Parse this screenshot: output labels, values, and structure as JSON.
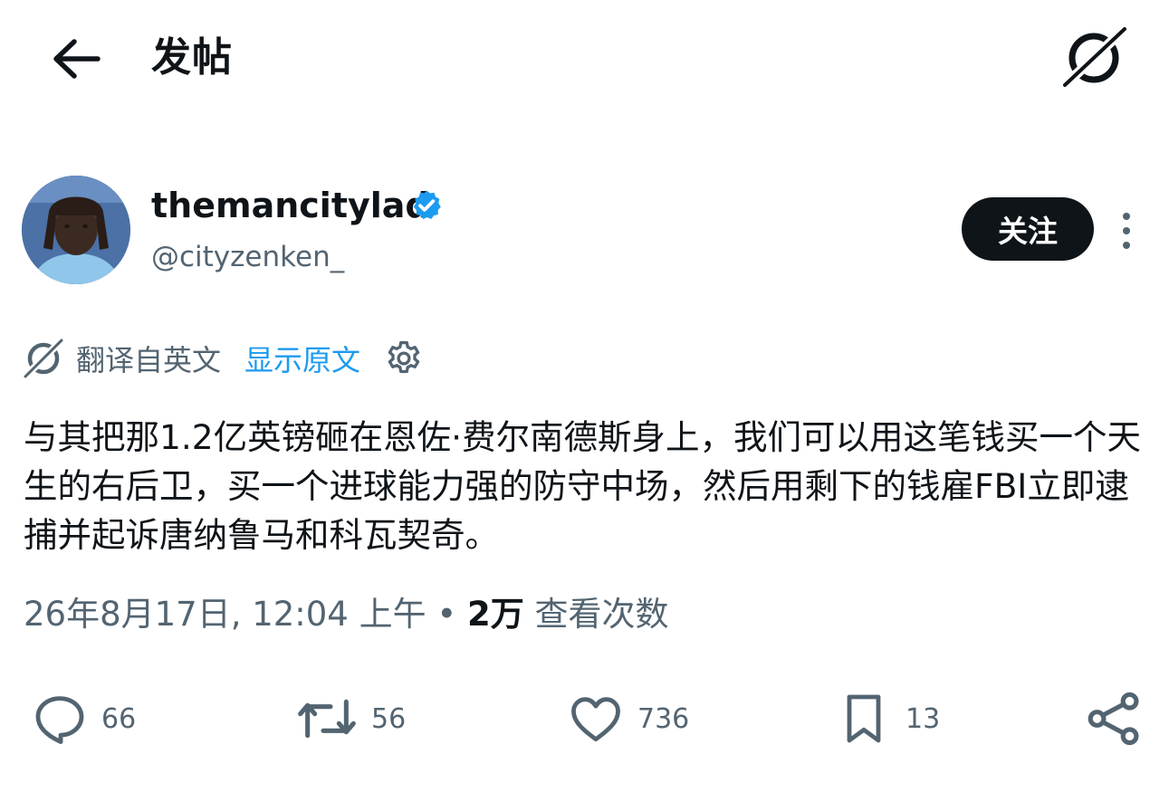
{
  "header": {
    "title": "发帖",
    "back_icon": "arrow-left-icon",
    "grok_icon": "grok-icon"
  },
  "author": {
    "display_name": "themancitylad",
    "handle": "@cityzenken_",
    "verified": true,
    "verified_color": "#1d9bf0",
    "follow_label": "关注"
  },
  "translation": {
    "translated_from": "翻译自英文",
    "show_original": "显示原文"
  },
  "post": {
    "text": "与其把那1.2亿英镑砸在恩佐·费尔南德斯身上，我们可以用这笔钱买一个天生的右后卫，买一个进球能力强的防守中场，然后用剩下的钱雇FBI立即逮捕并起诉唐纳鲁马和科瓦契奇。"
  },
  "meta": {
    "timestamp": "26年8月17日, 12:04 上午",
    "separator": " • ",
    "views_count": "2万",
    "views_label": " 查看次数"
  },
  "actions": {
    "replies": "66",
    "reposts": "56",
    "likes": "736",
    "bookmarks": "13"
  },
  "colors": {
    "text": "#0f1419",
    "secondary": "#536471",
    "accent": "#1d9bf0",
    "follow_bg": "#0f1419"
  }
}
